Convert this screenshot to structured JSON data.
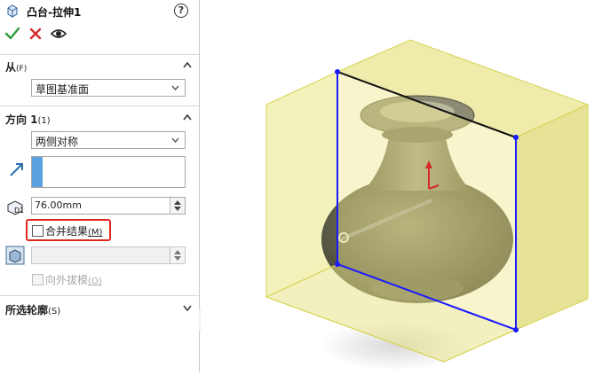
{
  "feature": {
    "title": "凸台-拉伸1",
    "help_glyph": "?",
    "icons": [
      "boss-extrude-icon",
      "help-icon",
      "ok-check-icon",
      "cancel-x-icon",
      "preview-eye-icon"
    ]
  },
  "from_section": {
    "title": "从",
    "mnemonic": "(F)",
    "dropdown_value": "草图基准面"
  },
  "direction_section": {
    "title": "方向 1",
    "mnemonic": "(1)",
    "end_condition": "两侧对称",
    "depth_value": "76.00mm",
    "merge_result_label": "合并结果",
    "merge_result_mnemonic": "(M)",
    "merge_result_checked": false,
    "draft_value": "",
    "draft_outward_label": "向外拔模",
    "draft_outward_mnemonic": "(O)",
    "draft_outward_checked": false,
    "draft_outward_enabled": false
  },
  "contours_section": {
    "title": "所选轮廓",
    "mnemonic": "(S)"
  },
  "colors": {
    "accept_green": "#2e9e3a",
    "cancel_red": "#d62a2a",
    "highlight_red": "#e0281e",
    "selection_blue": "#1a1aff",
    "extrude_preview_yellow": "#e6e27a",
    "list_selected_blue": "#5ba3e0"
  }
}
